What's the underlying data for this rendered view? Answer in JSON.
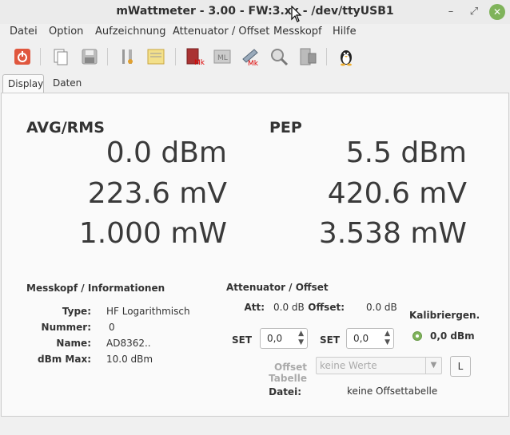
{
  "window": {
    "title": "mWattmeter - 3.00 - FW:3.xx - /dev/ttyUSB1"
  },
  "menu": [
    "Datei",
    "Option",
    "Aufzeichnung",
    "Attenuator / Offset",
    "Messkopf",
    "Hilfe"
  ],
  "tabs": [
    "Display",
    "Daten"
  ],
  "avg": {
    "title": "AVG/RMS",
    "dbm": "0.0 dBm",
    "mv": "223.6 mV",
    "mw": "1.000 mW"
  },
  "pep": {
    "title": "PEP",
    "dbm": "5.5 dBm",
    "mv": "420.6 mV",
    "mw": "3.538 mW"
  },
  "messkopf": {
    "title": "Messkopf / Informationen",
    "type_label": "Type:",
    "type_value": "HF Logarithmisch",
    "nummer_label": "Nummer:",
    "nummer_value": "0",
    "name_label": "Name:",
    "name_value": "AD8362..",
    "dbmmax_label": "dBm Max:",
    "dbmmax_value": "10.0 dBm"
  },
  "attenuator": {
    "title": "Attenuator / Offset",
    "att_label": "Att:",
    "att_value": "0.0 dB",
    "offset_label": "Offset:",
    "offset_value": "0.0 dB",
    "set_label": "SET",
    "att_spin": "0,0",
    "offset_spin": "0,0",
    "kalib_label": "Kalibriergen.",
    "kalib_value": "0,0 dBm",
    "offset_tabelle_label": "Offset Tabelle",
    "offset_tabelle_value": "keine Werte",
    "l_button": "L",
    "datei_label": "Datei:",
    "datei_value": "keine Offsettabelle"
  }
}
